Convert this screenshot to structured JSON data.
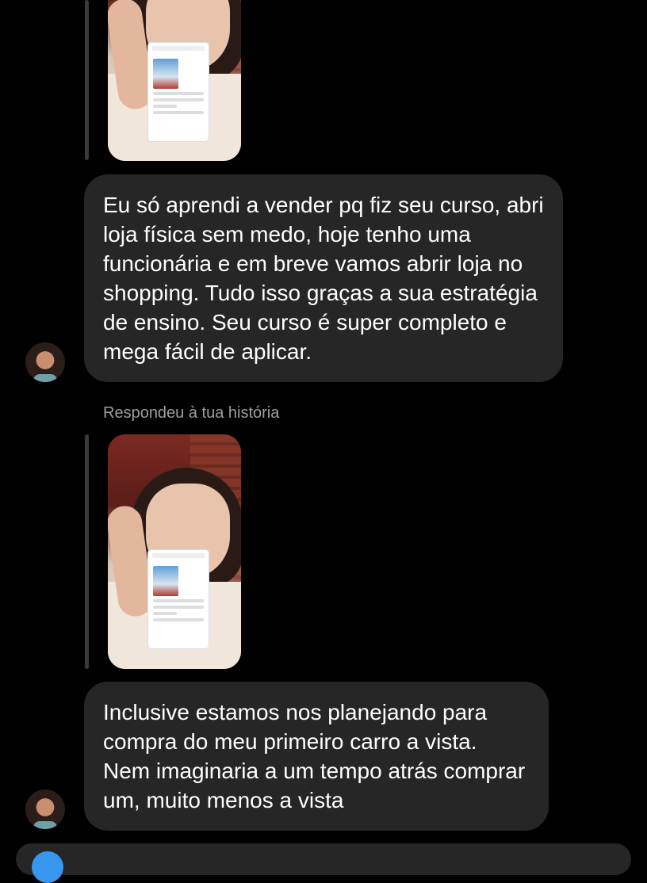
{
  "messages": [
    {
      "text": "Eu só aprendi a vender pq fiz seu curso, abri loja física sem medo, hoje tenho uma funcionária e em breve vamos abrir loja no shopping. Tudo isso graças a sua estratégia de ensino. Seu curso é super completo e mega fácil de aplicar."
    },
    {
      "reply_label": "Respondeu à tua história",
      "text": "Inclusive estamos nos planejando para compra do meu primeiro carro a vista. Nem imaginaria a um tempo atrás comprar um, muito menos a vista"
    }
  ],
  "colors": {
    "background": "#000000",
    "bubble": "#262626",
    "meta_text": "#9e9e9e",
    "accent": "#3797f0"
  }
}
